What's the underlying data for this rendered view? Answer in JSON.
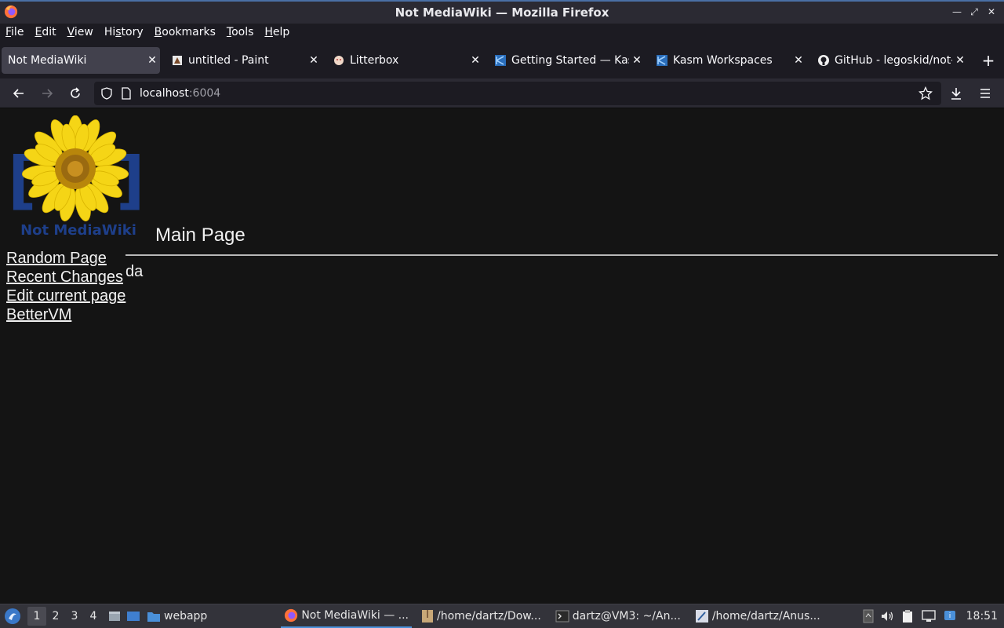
{
  "window": {
    "title": "Not MediaWiki — Mozilla Firefox"
  },
  "menu": [
    "File",
    "Edit",
    "View",
    "History",
    "Bookmarks",
    "Tools",
    "Help"
  ],
  "menu_accel": [
    "F",
    "E",
    "V",
    "s",
    "B",
    "T",
    "H"
  ],
  "tabs": [
    {
      "label": "Not MediaWiki",
      "icon": "none",
      "active": true
    },
    {
      "label": "untitled - Paint",
      "icon": "paint-icon",
      "active": false
    },
    {
      "label": "Litterbox",
      "icon": "litterbox-icon",
      "active": false
    },
    {
      "label": "Getting Started — Kasm",
      "icon": "kasm-icon",
      "active": false
    },
    {
      "label": "Kasm Workspaces",
      "icon": "kasm-icon",
      "active": false
    },
    {
      "label": "GitHub - legoskid/not-mediawiki",
      "icon": "github-icon",
      "active": false
    }
  ],
  "url": {
    "host": "localhost",
    "port": ":6004"
  },
  "logo_text": "Not MediaWiki",
  "sidebar": {
    "links": [
      "Random Page",
      "Recent Changes",
      "Edit current page",
      "BetterVM"
    ]
  },
  "page": {
    "heading": "Main Page",
    "body": "da"
  },
  "taskbar": {
    "workspaces": [
      "1",
      "2",
      "3",
      "4"
    ],
    "items": [
      {
        "label": "webapp",
        "icon": "folder-icon"
      },
      {
        "label": "Not MediaWiki — ...",
        "icon": "firefox-icon",
        "active": true
      },
      {
        "label": "/home/dartz/Dow...",
        "icon": "archive-icon"
      },
      {
        "label": "dartz@VM3: ~/An...",
        "icon": "terminal-icon"
      },
      {
        "label": "/home/dartz/Anus...",
        "icon": "editor-icon"
      }
    ],
    "clock": "18:51"
  },
  "colors": {
    "accent": "#4a90d9",
    "page_bg": "#141414",
    "chrome_bg": "#2b2a33"
  }
}
